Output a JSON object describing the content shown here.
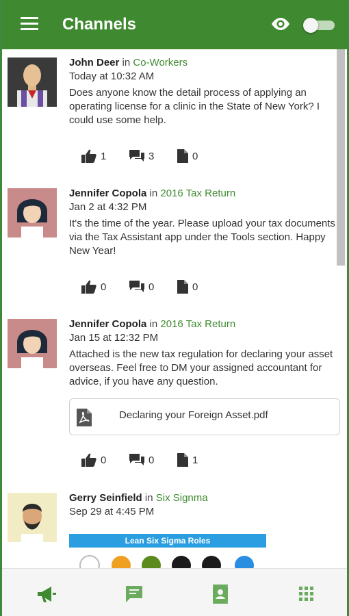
{
  "app": {
    "title": "Channels"
  },
  "header": {
    "menu_icon": "menu-icon",
    "eye_icon": "visibility-icon",
    "toggle_state": "off"
  },
  "posts": [
    {
      "author": "John Deer",
      "in_word": "in",
      "channel": "Co-Workers",
      "timestamp": "Today at 10:32 AM",
      "text": "Does anyone know the detail process of applying an operating license for a clinic in the State of New York? I could use some help.",
      "likes": "1",
      "comments": "3",
      "files": "0"
    },
    {
      "author": "Jennifer Copola",
      "in_word": "in",
      "channel": "2016 Tax Return",
      "timestamp": "Jan 2 at 4:32 PM",
      "text": "It's the time of the year. Please upload your tax documents via the Tax Assistant app under the Tools section. Happy New Year!",
      "likes": "0",
      "comments": "0",
      "files": "0"
    },
    {
      "author": "Jennifer Copola",
      "in_word": "in",
      "channel": "2016 Tax Return",
      "timestamp": "Jan 15 at 12:32 PM",
      "text": "Attached is the new tax regulation for declaring your asset overseas. Feel free to DM your assigned accountant for advice, if you have any question.",
      "attachment": "Declaring your Foreign Asset.pdf",
      "likes": "0",
      "comments": "0",
      "files": "1"
    },
    {
      "author": "Gerry Seinfield",
      "in_word": "in",
      "channel": "Six Signma",
      "timestamp": "Sep 29 at 4:45 PM",
      "image_title": "Lean Six Sigma Roles"
    }
  ],
  "bottom_nav": [
    {
      "icon": "megaphone-icon",
      "active": true
    },
    {
      "icon": "chat-icon",
      "active": false
    },
    {
      "icon": "contact-card-icon",
      "active": false
    },
    {
      "icon": "apps-grid-icon",
      "active": false
    }
  ],
  "colors": {
    "primary": "#3f8a30",
    "accent_text": "#3f8a30",
    "nav_icon": "#6aab5e"
  }
}
